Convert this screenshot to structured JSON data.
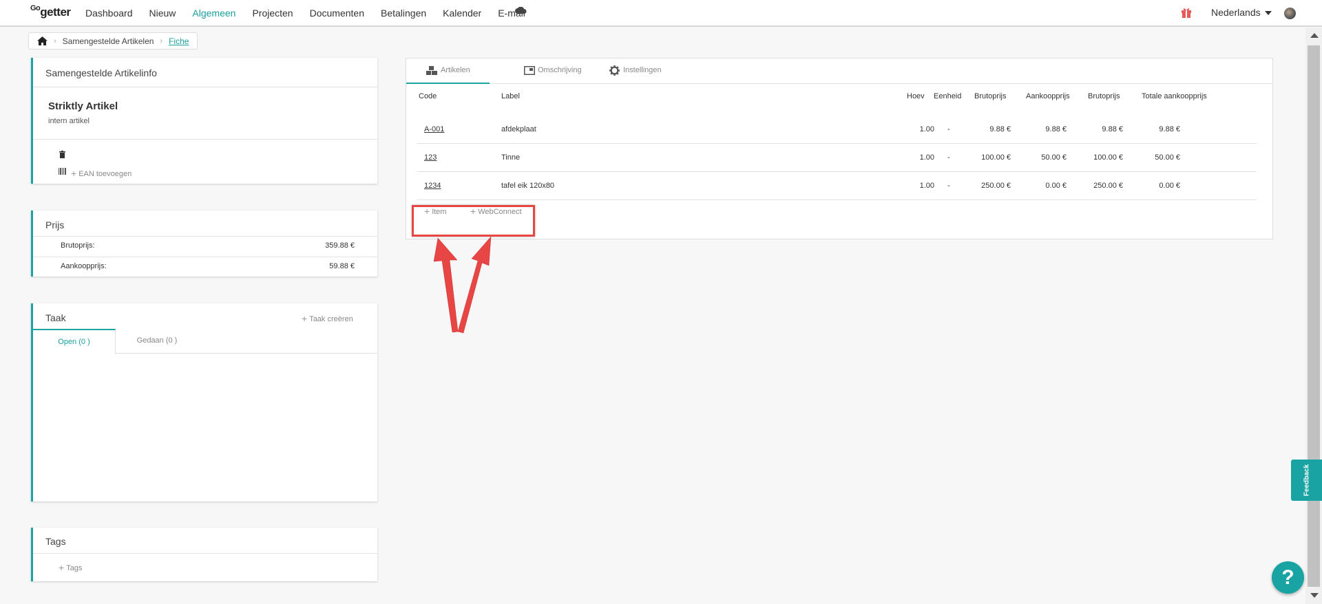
{
  "nav": {
    "logo_small": "Go",
    "logo_main": "getter",
    "items": [
      "Dashboard",
      "Nieuw",
      "Algemeen",
      "Projecten",
      "Documenten",
      "Betalingen",
      "Kalender",
      "E-mail"
    ],
    "active_item": "Algemeen",
    "language": "Nederlands",
    "accent_color": "#1aa3a3"
  },
  "breadcrumb": {
    "items": [
      "Samengestelde Artikelen",
      "Fiche"
    ]
  },
  "info_card": {
    "title": "Samengestelde Artikelinfo",
    "name": "Striktly Artikel",
    "subtitle": "intern artikel",
    "ean_label": "EAN toevoegen"
  },
  "price_card": {
    "title": "Prijs",
    "rows": [
      {
        "label": "Brutoprijs:",
        "value": "359.88 €"
      },
      {
        "label": "Aankoopprijs:",
        "value": "59.88 €"
      }
    ]
  },
  "task_card": {
    "title": "Taak",
    "create_label": "Taak creëren",
    "tabs": [
      "Open (0 )",
      "Gedaan (0 )"
    ]
  },
  "tags_card": {
    "title": "Tags",
    "add_label": "Tags"
  },
  "main": {
    "tabs": [
      {
        "label": "Artikelen",
        "icon": "boxes-icon"
      },
      {
        "label": "Omschrijving",
        "icon": "window-icon"
      },
      {
        "label": "Instellingen",
        "icon": "gear-icon"
      }
    ],
    "columns": [
      "Code",
      "Label",
      "Hoev",
      "Eenheid",
      "Brutoprijs",
      "Aankoopprijs",
      "Brutoprijs",
      "Totale aankoopprijs"
    ],
    "rows": [
      {
        "code": "A-001",
        "label": "afdekplaat",
        "qty": "1.00",
        "unit": "-",
        "gross": "9.88 €",
        "purchase": "9.88 €",
        "gross_total": "9.88 €",
        "purchase_total": "9.88 €"
      },
      {
        "code": "123",
        "label": "Tinne",
        "qty": "1.00",
        "unit": "-",
        "gross": "100.00 €",
        "purchase": "50.00 €",
        "gross_total": "100.00 €",
        "purchase_total": "50.00 €"
      },
      {
        "code": "1234",
        "label": "tafel eik 120x80",
        "qty": "1.00",
        "unit": "-",
        "gross": "250.00 €",
        "purchase": "0.00 €",
        "gross_total": "250.00 €",
        "purchase_total": "0.00 €"
      }
    ],
    "add_item_label": "Item",
    "add_webconnect_label": "WebConnect"
  },
  "feedback_label": "Feedback",
  "help_label": "?",
  "annotation_color": "#e84545"
}
